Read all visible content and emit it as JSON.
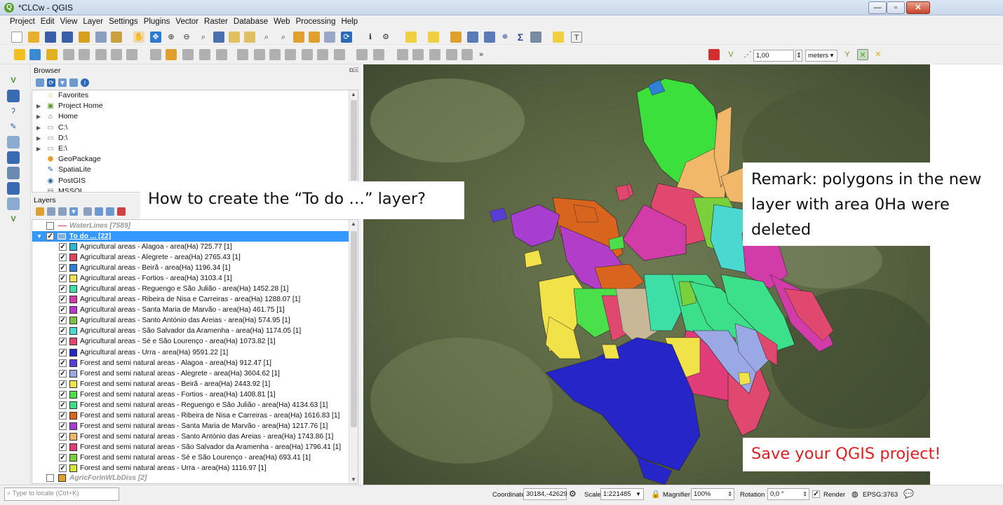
{
  "window": {
    "title": "*CLCw - QGIS",
    "minimize": "—",
    "maximize": "▫",
    "close": "✕"
  },
  "menu": [
    "Project",
    "Edit",
    "View",
    "Layer",
    "Settings",
    "Plugins",
    "Vector",
    "Raster",
    "Database",
    "Web",
    "Processing",
    "Help"
  ],
  "snapping": {
    "tolerance": "1,00",
    "units": "meters ▾"
  },
  "browser": {
    "title": "Browser",
    "items": [
      {
        "label": "Favorites",
        "icon": "star-icon",
        "arrow": ""
      },
      {
        "label": "Project Home",
        "icon": "folder-home-icon",
        "arrow": "▶"
      },
      {
        "label": "Home",
        "icon": "home-icon",
        "arrow": "▶"
      },
      {
        "label": "C:\\",
        "icon": "folder-icon",
        "arrow": "▶"
      },
      {
        "label": "D:\\",
        "icon": "folder-icon",
        "arrow": "▶"
      },
      {
        "label": "E:\\",
        "icon": "folder-icon",
        "arrow": "▶"
      },
      {
        "label": "GeoPackage",
        "icon": "geopackage-icon",
        "arrow": ""
      },
      {
        "label": "SpatiaLite",
        "icon": "spatialite-icon",
        "arrow": ""
      },
      {
        "label": "PostGIS",
        "icon": "postgis-icon",
        "arrow": ""
      },
      {
        "label": "MSSQL",
        "icon": "mssql-icon",
        "arrow": ""
      }
    ]
  },
  "layers": {
    "title": "Layers",
    "top_layer": "WaterLines [7589]",
    "group": "To do ... [22]",
    "bottom_layer": "AgricForInWLbDiss [2]",
    "items": [
      {
        "label": "Agricultural areas - Alagoa - area(Ha) 725.77 [1]",
        "color": "#29b6d6"
      },
      {
        "label": "Agricultural areas - Alegrete - area(Ha) 2765.43 [1]",
        "color": "#e0465a"
      },
      {
        "label": "Agricultural areas - Beirã - area(Ha) 1196.34 [1]",
        "color": "#2f7fd6"
      },
      {
        "label": "Agricultural areas - Fortios - area(Ha) 3103.4 [1]",
        "color": "#f2e25a"
      },
      {
        "label": "Agricultural areas - Reguengo e São Julião - area(Ha) 1452.28 [1]",
        "color": "#3ce0a6"
      },
      {
        "label": "Agricultural areas - Ribeira de Nisa e Carreiras - area(Ha) 1288.07 [1]",
        "color": "#d23ca8"
      },
      {
        "label": "Agricultural areas - Santa Maria de Marvão - area(Ha) 461.75 [1]",
        "color": "#b23ec8"
      },
      {
        "label": "Agricultural areas - Santo António das Areias - area(Ha) 574.95 [1]",
        "color": "#7cc24a"
      },
      {
        "label": "Agricultural areas - São Salvador da Aramenha - area(Ha) 1174.05 [1]",
        "color": "#4ad8d0"
      },
      {
        "label": "Agricultural areas - Sé e São Lourenço - area(Ha) 1073.82 [1]",
        "color": "#e04870"
      },
      {
        "label": "Agricultural areas - Urra - area(Ha) 9591.22 [1]",
        "color": "#2626c8"
      },
      {
        "label": "Forest and semi natural areas - Alagoa - area(Ha) 912.47 [1]",
        "color": "#5a3cd6"
      },
      {
        "label": "Forest and semi natural areas - Alegrete - area(Ha) 3604.62 [1]",
        "color": "#9aa8e6"
      },
      {
        "label": "Forest and semi natural areas - Beirã - area(Ha) 2443.92 [1]",
        "color": "#f2e24a"
      },
      {
        "label": "Forest and semi natural areas - Fortios - area(Ha) 1408.81 [1]",
        "color": "#4ae04a"
      },
      {
        "label": "Forest and semi natural areas - Reguengo e São Julião - area(Ha) 4134.63 [1]",
        "color": "#3ce08a"
      },
      {
        "label": "Forest and semi natural areas - Ribeira de Nisa e Carreiras - area(Ha) 1616.83 [1]",
        "color": "#d8641e"
      },
      {
        "label": "Forest and semi natural areas - Santa Maria de Marvão - area(Ha) 1217.76 [1]",
        "color": "#a83ed0"
      },
      {
        "label": "Forest and semi natural areas - Santo António das Areias - area(Ha) 1743.86 [1]",
        "color": "#f2b86a"
      },
      {
        "label": "Forest and semi natural areas - São Salvador da Aramenha - area(Ha) 1796.41 [1]",
        "color": "#e03c7a"
      },
      {
        "label": "Forest and semi natural areas - Sé e São Lourenço - area(Ha) 693.41 [1]",
        "color": "#7ad03a"
      },
      {
        "label": "Forest and semi natural areas - Urra - area(Ha) 1116.97 [1]",
        "color": "#d6e63a"
      }
    ]
  },
  "callouts": {
    "question": "How to create the “To do …” layer?",
    "remark": "Remark: polygons in the new layer with area 0Ha were deleted",
    "save": "Save your QGIS project!"
  },
  "status": {
    "locate_placeholder": "Type to locate (Ctrl+K)",
    "coordinate_label": "Coordinate",
    "coordinate": "30184,-42629",
    "scale_label": "Scale",
    "scale": "1:221485",
    "magnifier_label": "Magnifier",
    "magnifier": "100%",
    "rotation_label": "Rotation",
    "rotation": "0,0 °",
    "render_label": "Render",
    "crs": "EPSG:3763"
  }
}
